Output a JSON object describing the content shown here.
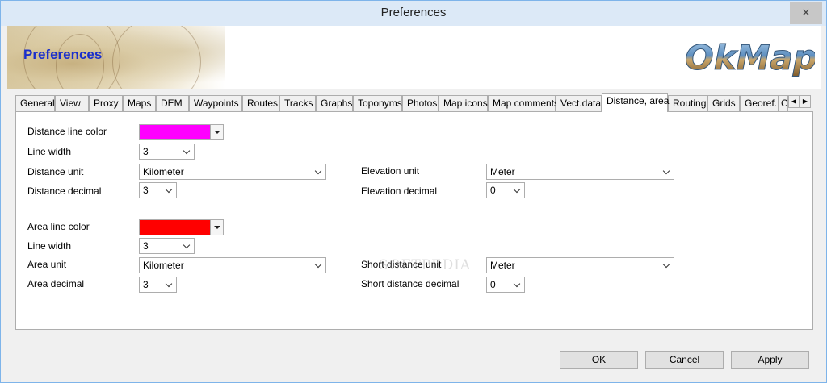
{
  "window": {
    "title": "Preferences",
    "close_glyph": "✕"
  },
  "banner": {
    "title": "Preferences",
    "logo_text": "OkMap"
  },
  "tabs": [
    {
      "label": "General"
    },
    {
      "label": "View"
    },
    {
      "label": "Proxy"
    },
    {
      "label": "Maps"
    },
    {
      "label": "DEM"
    },
    {
      "label": "Waypoints"
    },
    {
      "label": "Routes"
    },
    {
      "label": "Tracks"
    },
    {
      "label": "Graphs"
    },
    {
      "label": "Toponyms"
    },
    {
      "label": "Photos"
    },
    {
      "label": "Map icons"
    },
    {
      "label": "Map comments"
    },
    {
      "label": "Vect.data"
    },
    {
      "label": "Distance, area"
    },
    {
      "label": "Routing"
    },
    {
      "label": "Grids"
    },
    {
      "label": "Georef."
    },
    {
      "label": "C"
    }
  ],
  "active_tab": "Distance, area",
  "distance": {
    "line_color_label": "Distance line color",
    "line_color": "#ff00ff",
    "line_width_label": "Line width",
    "line_width": "3",
    "unit_label": "Distance unit",
    "unit": "Kilometer",
    "decimal_label": "Distance decimal",
    "decimal": "3",
    "elevation_unit_label": "Elevation unit",
    "elevation_unit": "Meter",
    "elevation_decimal_label": "Elevation decimal",
    "elevation_decimal": "0"
  },
  "area": {
    "line_color_label": "Area line color",
    "line_color": "#ff0000",
    "line_width_label": "Line width",
    "line_width": "3",
    "unit_label": "Area unit",
    "unit": "Kilometer",
    "decimal_label": "Area decimal",
    "decimal": "3",
    "short_distance_unit_label": "Short distance unit",
    "short_distance_unit": "Meter",
    "short_distance_decimal_label": "Short distance decimal",
    "short_distance_decimal": "0"
  },
  "watermark": "SOFTPEDIA",
  "buttons": {
    "ok": "OK",
    "cancel": "Cancel",
    "apply": "Apply"
  }
}
